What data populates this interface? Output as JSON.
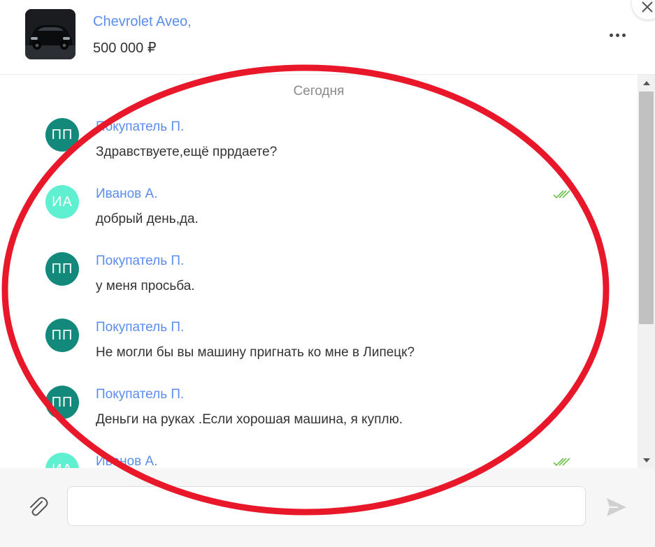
{
  "header": {
    "car_title": "Chevrolet Aveo,",
    "car_price": "500 000 ₽",
    "more_icon": "more-horizontal-icon",
    "close_icon": "close-icon"
  },
  "chat": {
    "date_separator": "Сегодня",
    "messages": [
      {
        "initials": "ПП",
        "author": "Покупатель П.",
        "text": "Здравствуете,ещё пррдаете?",
        "avatar_color": "#12897a",
        "read": false
      },
      {
        "initials": "ИА",
        "author": "Иванов А.",
        "text": "добрый день,да.",
        "avatar_color": "#5ef0d0",
        "read": true
      },
      {
        "initials": "ПП",
        "author": "Покупатель П.",
        "text": "у меня просьба.",
        "avatar_color": "#12897a",
        "read": false
      },
      {
        "initials": "ПП",
        "author": "Покупатель П.",
        "text": "Не могли бы вы машину пригнать ко мне в Липецк?",
        "avatar_color": "#12897a",
        "read": false
      },
      {
        "initials": "ПП",
        "author": "Покупатель П.",
        "text": "Деньги на руках .Если хорошая машина, я куплю.",
        "avatar_color": "#12897a",
        "read": false
      },
      {
        "initials": "ИА",
        "author": "Иванов А.",
        "text": "",
        "avatar_color": "#5ef0d0",
        "read": true
      }
    ]
  },
  "composer": {
    "attach_icon": "paperclip-icon",
    "input_value": "",
    "input_placeholder": "",
    "send_icon": "send-icon"
  },
  "colors": {
    "accent_link": "#5b8df0",
    "read_check": "#6cc24a",
    "annotation_ellipse": "#e8182a"
  }
}
